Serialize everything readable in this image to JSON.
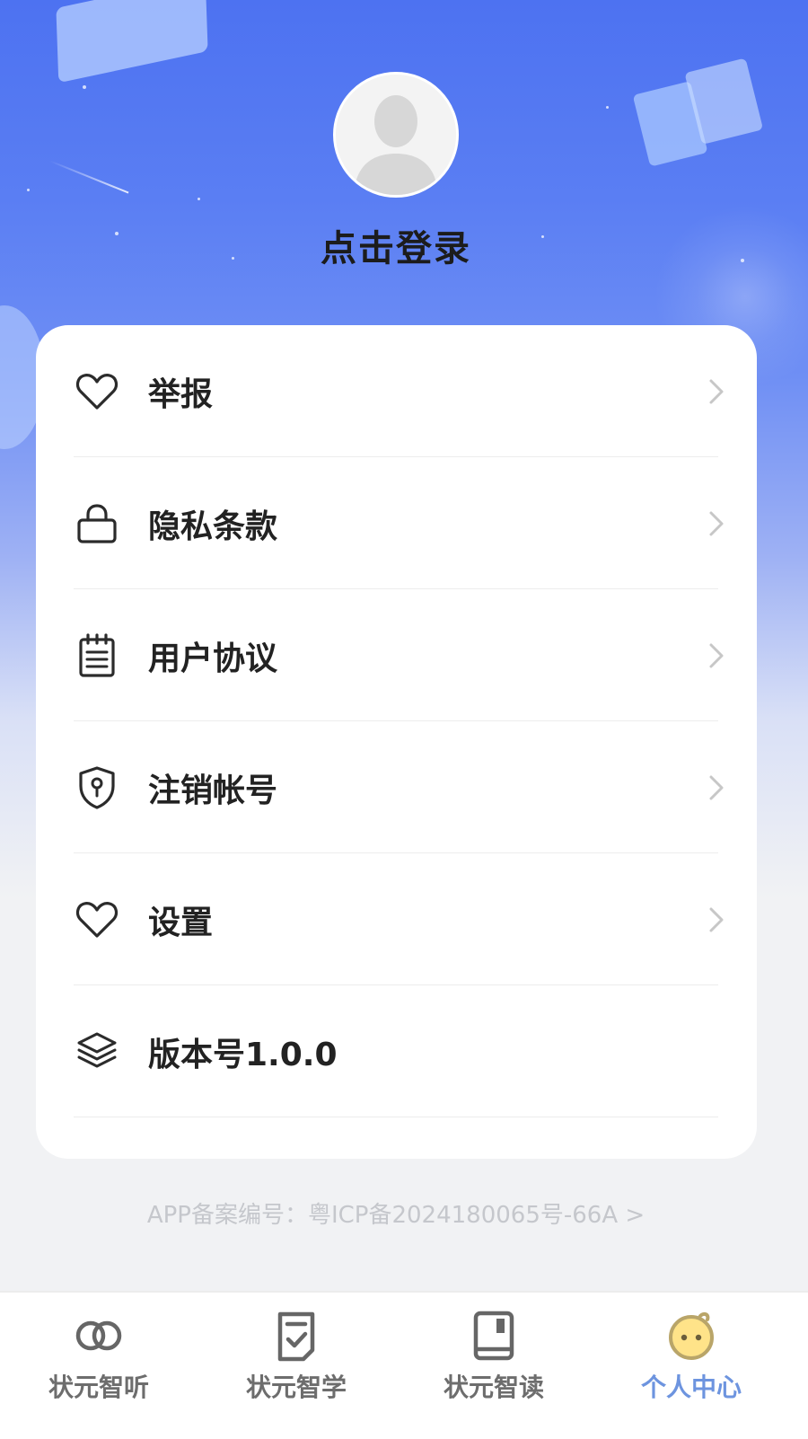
{
  "colors": {
    "hero_top": "#4d72f1",
    "hero_bottom": "#f1f2f4",
    "card_bg": "#ffffff",
    "text_primary": "#222222",
    "chevron": "#c7c7c7",
    "tab_inactive": "#6d6d6d",
    "tab_active": "#6d94df",
    "icp_text": "#c5c7cc"
  },
  "profile": {
    "login_label": "点击登录"
  },
  "menu": {
    "items": [
      {
        "label": "举报",
        "icon": "heart-icon",
        "has_chevron": true
      },
      {
        "label": "隐私条款",
        "icon": "lock-icon",
        "has_chevron": true
      },
      {
        "label": "用户协议",
        "icon": "notepad-icon",
        "has_chevron": true
      },
      {
        "label": "注销帐号",
        "icon": "shield-icon",
        "has_chevron": true
      },
      {
        "label": "设置",
        "icon": "heart-icon",
        "has_chevron": true
      },
      {
        "label": "版本号1.0.0",
        "icon": "layers-icon",
        "has_chevron": false
      }
    ]
  },
  "footer": {
    "icp_text": "APP备案编号：粤ICP备2024180065号-66A >"
  },
  "tabbar": {
    "tabs": [
      {
        "label": "状元智听",
        "icon": "rings-icon",
        "active": false
      },
      {
        "label": "状元智学",
        "icon": "checklist-icon",
        "active": false
      },
      {
        "label": "状元智读",
        "icon": "book-icon",
        "active": false
      },
      {
        "label": "个人中心",
        "icon": "smiley-icon",
        "active": true
      }
    ]
  }
}
